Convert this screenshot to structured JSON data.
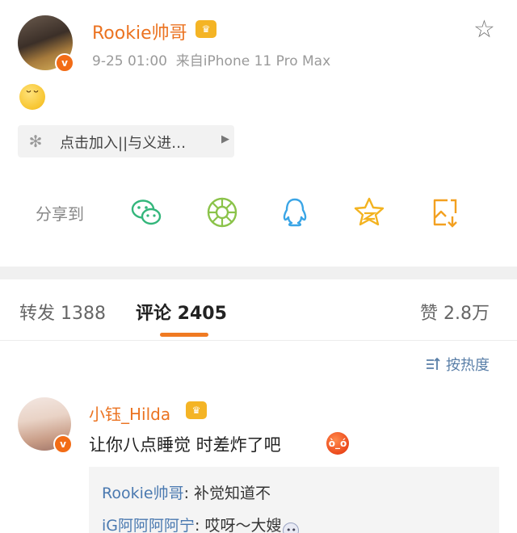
{
  "post": {
    "username": "Rookie帅哥",
    "time": "9-25 01:00",
    "source": "来自iPhone 11 Pro Max",
    "emoji_name": "sleepy-face-emoji",
    "supertopic_label": "点击加入||与义进…"
  },
  "share": {
    "label": "分享到",
    "targets": [
      "wechat-icon",
      "moments-icon",
      "qq-icon",
      "qzone-icon",
      "save-image-icon"
    ]
  },
  "tabs": {
    "repost": "转发 1388",
    "comment": "评论 2405",
    "like": "赞 2.8万"
  },
  "sort": {
    "label": "按热度"
  },
  "comment": {
    "author": "小钰_Hilda",
    "text": "让你八点睡觉 时差炸了吧",
    "emoji_name": "angry-face-emoji",
    "replies": [
      {
        "name": "Rookie帅哥",
        "sep": ": ",
        "text": "补觉知道不"
      },
      {
        "name": "iG阿阿阿阿宁",
        "sep": ": ",
        "text": "哎呀～大嫂"
      }
    ]
  },
  "colors": {
    "accent_orange": "#eb7321",
    "link_blue": "#4a79b0",
    "tab_underline": "#f07a22"
  }
}
